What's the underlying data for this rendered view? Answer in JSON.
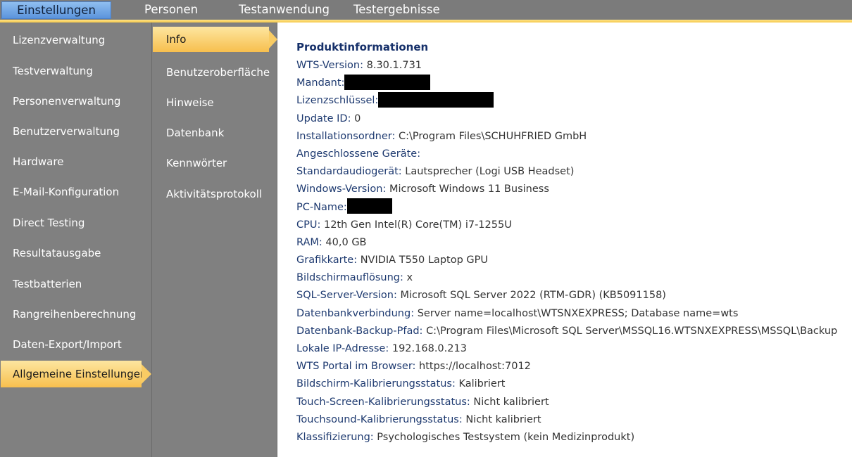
{
  "menu": {
    "items": [
      "Einstellungen",
      "Personen",
      "Testanwendung",
      "Testergebnisse"
    ],
    "active_index": 0
  },
  "sidebar": {
    "items": [
      "Lizenzverwaltung",
      "Testverwaltung",
      "Personenverwaltung",
      "Benutzerverwaltung",
      "Hardware",
      "E-Mail-Konfiguration",
      "Direct Testing",
      "Resultatausgabe",
      "Testbatterien",
      "Rangreihenberechnung",
      "Daten-Export/Import",
      "Allgemeine Einstellungen"
    ],
    "active_index": 11
  },
  "subnav": {
    "items": [
      "Info",
      "Benutzeroberfläche",
      "Hinweise",
      "Datenbank",
      "Kennwörter",
      "Aktivitätsprotokoll"
    ],
    "active_index": 0
  },
  "content": {
    "title": "Produktinformationen",
    "rows": [
      {
        "label": "WTS-Version:",
        "value": "8.30.1.731"
      },
      {
        "label": "Mandant:",
        "value": "",
        "redacted": true
      },
      {
        "label": "Lizenzschlüssel:",
        "value": "",
        "redacted": true
      },
      {
        "label": "Update ID:",
        "value": "0"
      },
      {
        "label": "Installationsordner:",
        "value": "C:\\Program Files\\SCHUHFRIED GmbH"
      },
      {
        "label": "Angeschlossene Geräte:",
        "value": ""
      },
      {
        "label": "Standardaudiogerät:",
        "value": "Lautsprecher (Logi USB Headset)"
      },
      {
        "label": "Windows-Version:",
        "value": "Microsoft Windows 11 Business"
      },
      {
        "label": "PC-Name:",
        "value": "",
        "redacted": true
      },
      {
        "label": "CPU:",
        "value": "12th Gen Intel(R) Core(TM) i7-1255U"
      },
      {
        "label": "RAM:",
        "value": "40,0 GB"
      },
      {
        "label": "Grafikkarte:",
        "value": "NVIDIA T550 Laptop GPU"
      },
      {
        "label": "Bildschirmauflösung:",
        "value": " x"
      },
      {
        "label": "SQL-Server-Version:",
        "value": "Microsoft SQL Server 2022 (RTM-GDR) (KB5091158)"
      },
      {
        "label": "Datenbankverbindung:",
        "value": "Server name=localhost\\WTSNXEXPRESS; Database name=wts"
      },
      {
        "label": "Datenbank-Backup-Pfad:",
        "value": "C:\\Program Files\\Microsoft SQL Server\\MSSQL16.WTSNXEXPRESS\\MSSQL\\Backup"
      },
      {
        "label": "Lokale IP-Adresse:",
        "value": "192.168.0.213"
      },
      {
        "label": "WTS Portal im Browser:",
        "value": "https://localhost:7012"
      },
      {
        "label": "Bildschirm-Kalibrierungsstatus:",
        "value": "Kalibriert"
      },
      {
        "label": "Touch-Screen-Kalibrierungsstatus:",
        "value": "Nicht kalibriert"
      },
      {
        "label": "Touchsound-Kalibrierungsstatus:",
        "value": "Nicht kalibriert"
      },
      {
        "label": "Klassifizierung:",
        "value": "Psychologisches Testsystem (kein Medizinprodukt)"
      }
    ]
  },
  "colors": {
    "menubar": "#7b7b7b",
    "sidebar": "#808080",
    "active_highlight": "#f7bf4e",
    "menu_active": "#5b94dc",
    "title": "#16306a",
    "label": "#1e3a70"
  }
}
